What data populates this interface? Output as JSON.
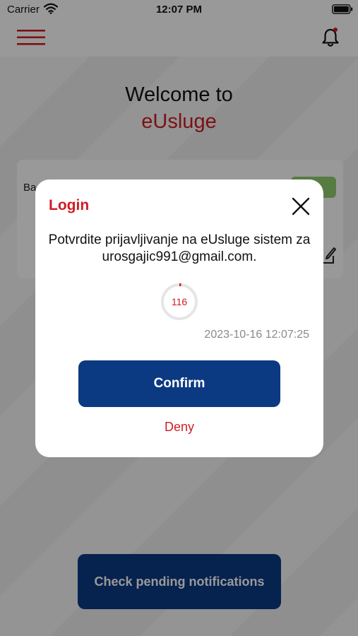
{
  "status_bar": {
    "carrier": "Carrier",
    "time": "12:07 PM"
  },
  "header": {
    "menu_icon": "hamburger-icon",
    "notification_icon": "bell-icon",
    "notification_dot_color": "#d01c24"
  },
  "home": {
    "welcome_line1": "Welcome to",
    "welcome_line2": "eUsluge",
    "card_label_partial": "Ba",
    "pending_button_label": "Check pending notifications"
  },
  "modal": {
    "title": "Login",
    "message": "Potvrdite prijavljivanje na eUsluge sistem za urosgajic991@gmail.com.",
    "countdown": 116,
    "timestamp": "2023-10-16 12:07:25",
    "confirm_label": "Confirm",
    "deny_label": "Deny",
    "close_icon": "close-icon"
  },
  "colors": {
    "brand_red": "#d01c24",
    "primary_blue": "#0b3a82",
    "success_green": "#8fcf6e",
    "timestamp_gray": "#8a8a8a"
  }
}
